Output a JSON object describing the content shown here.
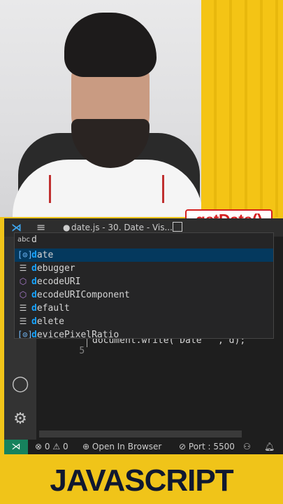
{
  "badge": {
    "text": "getDate()"
  },
  "window": {
    "title": "date.js - 30. Date - Vis...",
    "dirty_marker": "●",
    "menu_glyph": "≡",
    "logo_glyph": "⋊"
  },
  "suggest": {
    "kind_label": "abc",
    "query": "d",
    "items": [
      {
        "icon": "variable-icon",
        "glyph": "[⊙]",
        "match": "d",
        "rest": "ate"
      },
      {
        "icon": "keyword-icon",
        "glyph": "☰",
        "match": "d",
        "rest": "ebugger"
      },
      {
        "icon": "method-icon",
        "glyph": "⬡",
        "match": "d",
        "rest": "ecodeURI"
      },
      {
        "icon": "method-icon",
        "glyph": "⬡",
        "match": "d",
        "rest": "ecodeURIComponent"
      },
      {
        "icon": "keyword-icon",
        "glyph": "☰",
        "match": "d",
        "rest": "efault"
      },
      {
        "icon": "keyword-icon",
        "glyph": "☰",
        "match": "d",
        "rest": "elete"
      },
      {
        "icon": "variable-icon",
        "glyph": "[⊙]",
        "match": "d",
        "rest": "evicePixelRatio"
      }
    ]
  },
  "editor": {
    "line_number": "5",
    "code": "document.write(\"Date \" , d);"
  },
  "status": {
    "remote_glyph": "⋊",
    "errors": "0",
    "warnings": "0",
    "open_browser": "Open In Browser",
    "port": "Port : 5500"
  },
  "brand": {
    "text": "JAVASCRIPT"
  },
  "colors": {
    "accent_blue": "#18a3ff",
    "status_remote": "#16825d",
    "badge_red": "#d42020",
    "background_yellow": "#f0c419"
  }
}
